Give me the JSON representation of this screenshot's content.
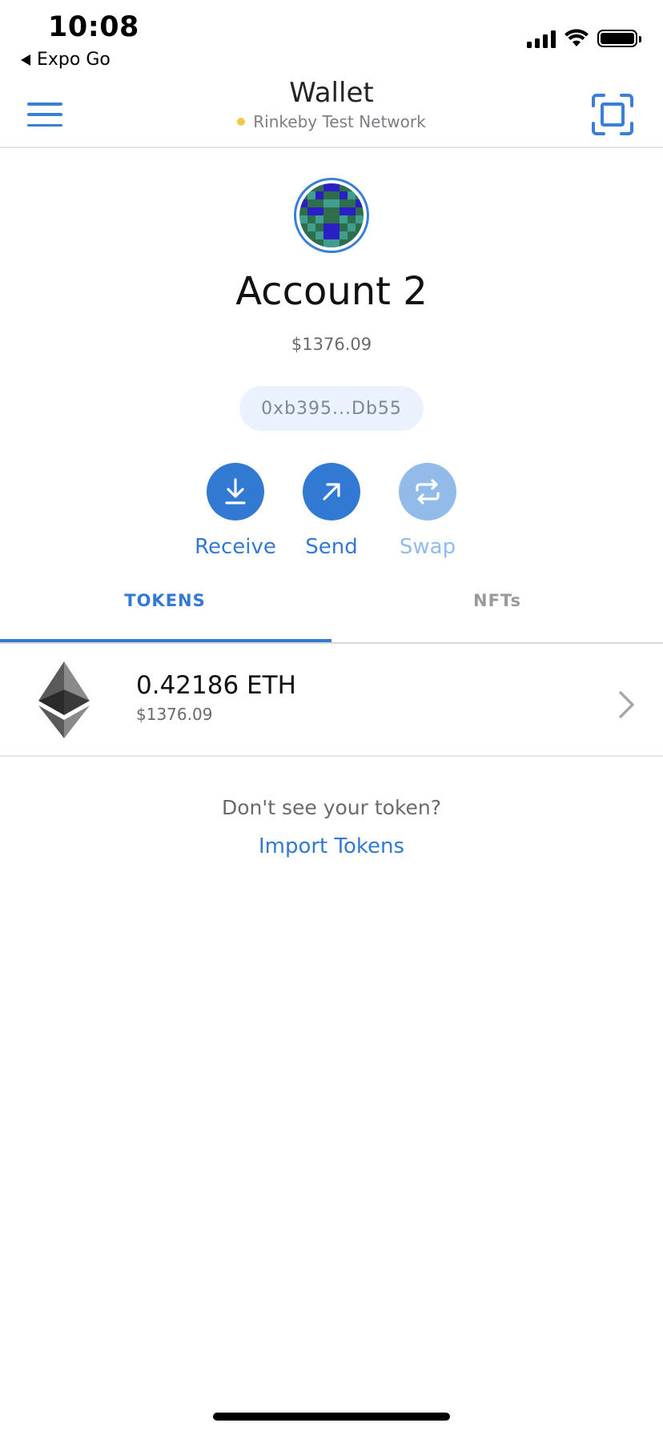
{
  "status_bar": {
    "time": "10:08",
    "back_app": "Expo Go"
  },
  "header": {
    "title": "Wallet",
    "network": "Rinkeby Test Network",
    "network_dot_color": "#f2c84b"
  },
  "account": {
    "name": "Account 2",
    "balance": "$1376.09",
    "address": "0xb395...Db55"
  },
  "actions": [
    {
      "label": "Receive",
      "icon": "download-icon",
      "enabled": true
    },
    {
      "label": "Send",
      "icon": "arrow-up-right-icon",
      "enabled": true
    },
    {
      "label": "Swap",
      "icon": "swap-icon",
      "enabled": false
    }
  ],
  "tabs": {
    "tokens": "TOKENS",
    "nfts": "NFTs",
    "active": "tokens"
  },
  "tokens": [
    {
      "amount": "0.42186 ETH",
      "fiat": "$1376.09",
      "icon": "ethereum-icon"
    }
  ],
  "import_prompt": {
    "question": "Don't see your token?",
    "link": "Import Tokens"
  },
  "colors": {
    "accent": "#3279d4",
    "accent_disabled": "#93bbe9"
  }
}
